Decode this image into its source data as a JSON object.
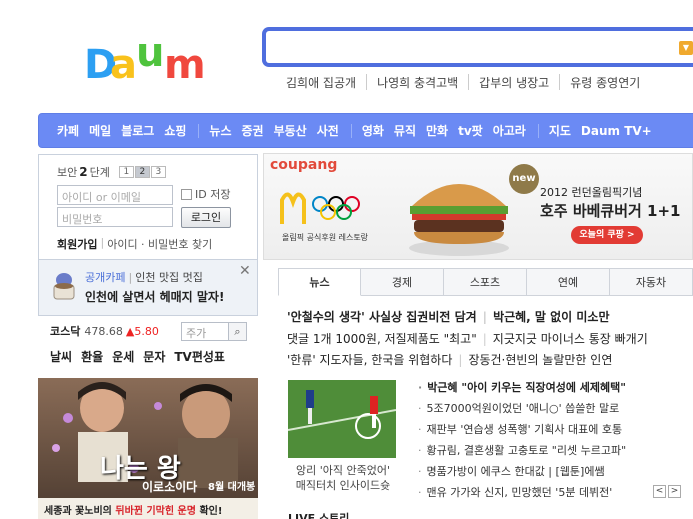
{
  "logo": {
    "text": "Daum"
  },
  "search": {
    "placeholder": ""
  },
  "trending": [
    "김희애 집공개",
    "나영희 충격고백",
    "갑부의 냉장고",
    "유령 종영연기"
  ],
  "nav": {
    "group1": [
      "카페",
      "메일",
      "블로그",
      "쇼핑"
    ],
    "group2": [
      "뉴스",
      "증권",
      "부동산",
      "사전"
    ],
    "group3": [
      "영화",
      "뮤직",
      "만화",
      "tv팟",
      "아고라"
    ],
    "group4": [
      "지도",
      "Daum TV+"
    ]
  },
  "login": {
    "security_label": "보안",
    "security_level": "2",
    "security_unit": "단계",
    "levels": [
      "1",
      "2",
      "3"
    ],
    "id_placeholder": "아이디 or 이메일",
    "pw_placeholder": "비밀번호",
    "id_save": "ID 저장",
    "login_button": "로그인",
    "signup": "회원가입",
    "find": "아이디 · 비밀번호 찾기"
  },
  "promo": {
    "cafe": "공개카페",
    "topic": "인천 맛집 멋집",
    "headline": "인천에 살면서 헤매지 말자!"
  },
  "stock": {
    "name": "코스닥",
    "value": "478.68",
    "change": "▲5.80",
    "input_placeholder": "주가"
  },
  "quick_links": [
    "날씨",
    "환율",
    "운세",
    "문자",
    "TV편성표"
  ],
  "left_ad": {
    "title": "나는 왕",
    "subtitle": "이로소이다",
    "release": "8월 대개봉",
    "caption_prefix": "세종과 꽃노비의",
    "caption_highlight": "뒤바뀐 기막힌 운명",
    "caption_suffix": "확인!"
  },
  "banner": {
    "brand": "coupang",
    "sub": "올림픽 공식후원 레스토랑",
    "badge": "new",
    "line1": "2012 런던올림픽기념",
    "line2": "호주 바베큐버거 1+1",
    "cta": "오늘의 쿠팡 >"
  },
  "news_tabs": [
    "뉴스",
    "경제",
    "스포츠",
    "연예",
    "자동차"
  ],
  "headlines": {
    "h1a": "'안철수의 생각' 사실상 집권비전 담겨",
    "h1b": "박근혜, 말 없이 미소만",
    "h2a": "댓글 1개 1000원, 저질제품도 \"최고\"",
    "h2b": "지긋지긋 마이너스 통장 빠개기",
    "h3a": "'한류' 지도자들, 한국을 위협하다",
    "h3b": "장동건·현빈의 놀랄만한 인연"
  },
  "thumb_caption": [
    "앙리 '아직 안죽었어'",
    "매직터치 인사이드슛"
  ],
  "news_list": [
    "박근혜 \"아이 키우는 직장여성에 세제혜택\"",
    "5조7000억원이었던 '애니○' 씁쓸한 말로",
    "재판부 '연습생 성폭행' 기획사 대표에 호통",
    "황규림, 결혼생활 고충토로 \"리셋 누르고파\"",
    "명품가방이 에쿠스 한대값 | [웹툰]에쌤",
    "맨유 가가와 신지, 민망했던 '5분 데뷔전'"
  ],
  "pager": [
    "<",
    ">"
  ],
  "live_label": "LIVE 스토리",
  "colors": {
    "nav_bg": "#6b8af4",
    "search_border": "#4f6ede",
    "stock_down": "#e22",
    "accent": "#f0a92e"
  }
}
